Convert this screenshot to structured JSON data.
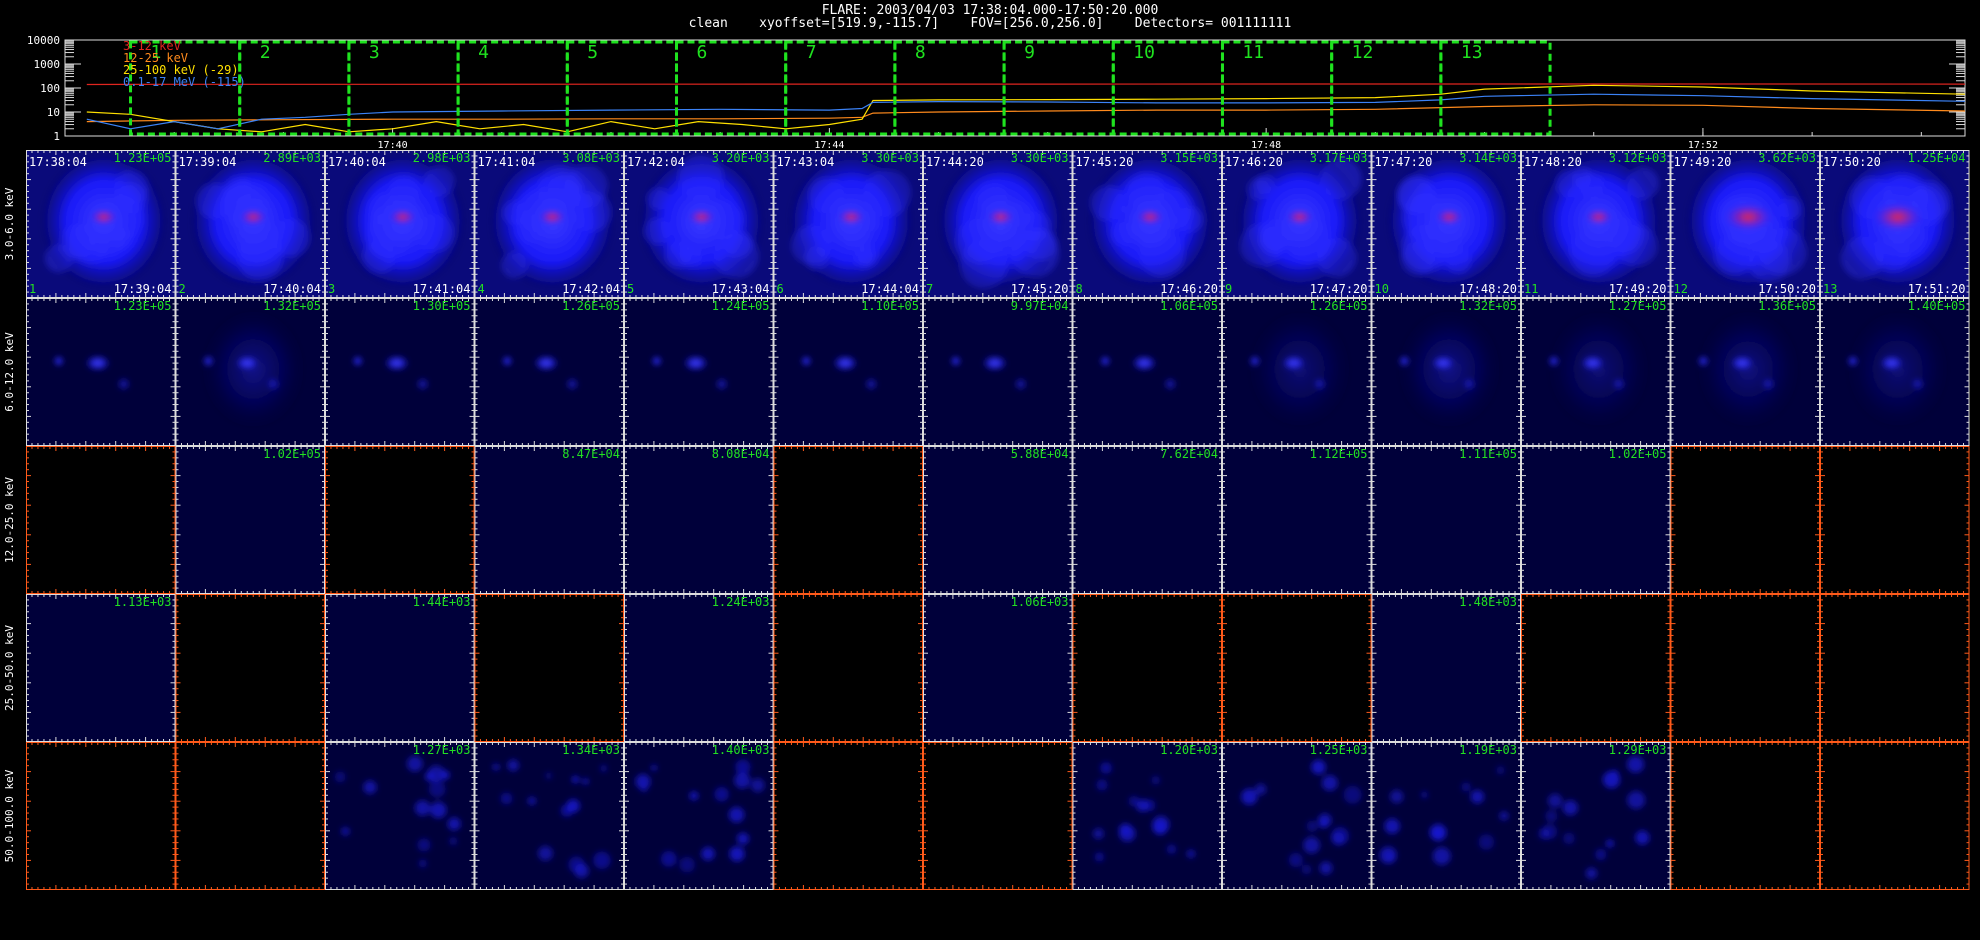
{
  "header": {
    "line1": "FLARE: 2003/04/03 17:38:04.000-17:50:20.000",
    "line2": "clean    xyoffset=[519.9,-115.7]    FOV=[256.0,256.0]    Detectors= 001111111"
  },
  "colors": {
    "c3_12": "#e0251f",
    "c12_25": "#ff8a1c",
    "c25_100": "#ffe000",
    "c100_17": "#3b82f6",
    "green_box": "#1fe21f",
    "intensity_label": "#22e022",
    "axis_white": "#dddddd",
    "axis_orange": "#ff5a1a",
    "image_blue": "#1a1aff",
    "image_red": "#ff2020"
  },
  "chart_data": [
    {
      "type": "line",
      "title": "",
      "y_scale": "log",
      "ylim": [
        1,
        10000
      ],
      "y_ticks": [
        "10000",
        "1000",
        "100",
        "10",
        "1"
      ],
      "x_ticks": [
        "17:40",
        "17:44",
        "17:48",
        "17:52"
      ],
      "x_tick_minutes": [
        40,
        44,
        48,
        52
      ],
      "xlim_minutes": [
        37.0,
        54.4
      ],
      "legend": {
        "placement": "top-left",
        "entries": [
          "3-12 keV",
          "12-25 keV",
          "25-100 keV (-29)",
          "0.1-17 MeV (-115)"
        ]
      },
      "series": [
        {
          "name": "3-12 keV",
          "color_key": "c3_12",
          "x": [
            37.2,
            38.0,
            40.0,
            42.0,
            44.0,
            45.0,
            46.0,
            48.0,
            50.0,
            52.0,
            54.4
          ],
          "values": [
            140,
            142,
            143,
            144,
            145,
            146,
            146,
            147,
            147,
            147,
            146
          ]
        },
        {
          "name": "12-25 keV",
          "color_key": "c12_25",
          "x": [
            37.2,
            38.0,
            39.0,
            40.0,
            41.0,
            42.0,
            43.0,
            44.0,
            44.3,
            44.4,
            45.0,
            46.0,
            47.0,
            48.0,
            49.0,
            50.0,
            51.0,
            52.0,
            53.0,
            54.4
          ],
          "values": [
            4,
            4.5,
            4.8,
            5,
            5,
            5.2,
            5.2,
            5.5,
            6,
            9,
            10,
            11,
            12,
            12,
            13,
            17,
            20,
            19,
            14,
            11
          ]
        },
        {
          "name": "25-100 keV (-29)",
          "color_key": "c25_100",
          "x": [
            37.2,
            37.6,
            38.0,
            38.4,
            38.8,
            39.2,
            39.6,
            40.0,
            40.4,
            40.8,
            41.2,
            41.6,
            42.0,
            42.4,
            42.8,
            43.2,
            43.6,
            44.0,
            44.3,
            44.4,
            45.0,
            46.0,
            47.0,
            48.0,
            49.0,
            49.6,
            50.0,
            51.0,
            52.0,
            53.0,
            54.4
          ],
          "values": [
            10,
            8,
            4,
            2,
            1.5,
            3,
            1.5,
            2,
            4,
            2,
            3,
            1.5,
            4,
            2,
            4,
            3,
            2,
            3,
            5,
            30,
            32,
            33,
            34,
            36,
            40,
            55,
            90,
            130,
            110,
            75,
            55
          ]
        },
        {
          "name": "0.1-17 MeV (-115)",
          "color_key": "c100_17",
          "x": [
            37.2,
            37.6,
            38.0,
            38.4,
            38.8,
            39.2,
            39.6,
            40.0,
            41.0,
            42.0,
            43.0,
            44.0,
            44.3,
            44.4,
            45.0,
            46.0,
            47.0,
            48.0,
            49.0,
            49.6,
            50.0,
            51.0,
            52.0,
            53.0,
            54.4
          ],
          "values": [
            5,
            2,
            4,
            2,
            5,
            6,
            8,
            10,
            11,
            12,
            13,
            12,
            14,
            25,
            27,
            26,
            24,
            24,
            25,
            32,
            45,
            55,
            48,
            36,
            28
          ]
        }
      ],
      "intervals": [
        {
          "label": "1",
          "start": 37.6,
          "end": 38.6
        },
        {
          "label": "2",
          "start": 38.6,
          "end": 39.6
        },
        {
          "label": "3",
          "start": 39.6,
          "end": 40.6
        },
        {
          "label": "4",
          "start": 40.6,
          "end": 41.6
        },
        {
          "label": "5",
          "start": 41.6,
          "end": 42.6
        },
        {
          "label": "6",
          "start": 42.6,
          "end": 43.6
        },
        {
          "label": "7",
          "start": 43.6,
          "end": 44.6
        },
        {
          "label": "8",
          "start": 44.6,
          "end": 45.6
        },
        {
          "label": "9",
          "start": 45.6,
          "end": 46.6
        },
        {
          "label": "10",
          "start": 46.6,
          "end": 47.6
        },
        {
          "label": "11",
          "start": 47.6,
          "end": 48.6
        },
        {
          "label": "12",
          "start": 48.6,
          "end": 49.6
        },
        {
          "label": "13",
          "start": 49.6,
          "end": 50.6
        }
      ]
    },
    {
      "type": "heatmap",
      "title": "",
      "rows": [
        "3.0-6.0 keV",
        "6.0-12.0 keV",
        "12.0-25.0 keV",
        "25.0-50.0 keV",
        "50.0-100.0 keV"
      ],
      "columns": [
        {
          "index": "1",
          "start": "17:38:04",
          "end": "17:39:04"
        },
        {
          "index": "2",
          "start": "17:39:04",
          "end": "17:40:04"
        },
        {
          "index": "3",
          "start": "17:40:04",
          "end": "17:41:04"
        },
        {
          "index": "4",
          "start": "17:41:04",
          "end": "17:42:04"
        },
        {
          "index": "5",
          "start": "17:42:04",
          "end": "17:43:04"
        },
        {
          "index": "6",
          "start": "17:43:04",
          "end": "17:44:04"
        },
        {
          "index": "7",
          "start": "17:44:20",
          "end": "17:45:20"
        },
        {
          "index": "8",
          "start": "17:45:20",
          "end": "17:46:20"
        },
        {
          "index": "9",
          "start": "17:46:20",
          "end": "17:47:20"
        },
        {
          "index": "10",
          "start": "17:47:20",
          "end": "17:48:20"
        },
        {
          "index": "11",
          "start": "17:48:20",
          "end": "17:49:20"
        },
        {
          "index": "12",
          "start": "17:49:20",
          "end": "17:50:20"
        },
        {
          "index": "13",
          "start": "17:50:20",
          "end": "17:51:20"
        }
      ],
      "peaks": [
        [
          "1.23E+05",
          "2.89E+03",
          "2.98E+03",
          "3.08E+03",
          "3.20E+03",
          "3.30E+03",
          "3.30E+03",
          "3.15E+03",
          "3.17E+03",
          "3.14E+03",
          "3.12E+03",
          "3.62E+03",
          "1.25E+04"
        ],
        [
          "1.23E+05",
          "1.32E+05",
          "1.30E+05",
          "1.26E+05",
          "1.24E+05",
          "1.10E+05",
          "9.97E+04",
          "1.06E+05",
          "1.26E+05",
          "1.32E+05",
          "1.27E+05",
          "1.36E+05",
          "1.40E+05"
        ],
        [
          "",
          "1.02E+05",
          "",
          "8.47E+04",
          "8.08E+04",
          "",
          "5.88E+04",
          "7.62E+04",
          "1.12E+05",
          "1.11E+05",
          "1.02E+05",
          "",
          ""
        ],
        [
          "1.13E+03",
          "",
          "1.44E+03",
          "",
          "1.24E+03",
          "",
          "1.06E+03",
          "",
          "",
          "1.48E+03",
          "",
          "",
          ""
        ],
        [
          "",
          "",
          "1.27E+03",
          "1.34E+03",
          "1.40E+03",
          "",
          "",
          "1.20E+03",
          "1.25E+03",
          "1.19E+03",
          "1.29E+03",
          "",
          ""
        ]
      ],
      "axis_color": [
        [
          "w",
          "w",
          "w",
          "w",
          "w",
          "w",
          "w",
          "w",
          "w",
          "w",
          "w",
          "w",
          "w"
        ],
        [
          "w",
          "w",
          "w",
          "w",
          "w",
          "w",
          "w",
          "w",
          "w",
          "w",
          "w",
          "w",
          "w"
        ],
        [
          "o",
          "w",
          "o",
          "w",
          "w",
          "o",
          "w",
          "w",
          "w",
          "w",
          "w",
          "o",
          "o"
        ],
        [
          "w",
          "o",
          "w",
          "o",
          "w",
          "o",
          "w",
          "o",
          "o",
          "w",
          "o",
          "o",
          "o"
        ],
        [
          "o",
          "o",
          "w",
          "w",
          "w",
          "o",
          "o",
          "w",
          "w",
          "w",
          "w",
          "o",
          "o"
        ]
      ],
      "intensity": [
        [
          1.0,
          1.0,
          1.0,
          1.0,
          1.0,
          1.0,
          1.0,
          1.0,
          1.0,
          1.0,
          1.0,
          1.0,
          1.0
        ],
        [
          0.15,
          0.45,
          0.12,
          0.12,
          0.12,
          0.12,
          0.12,
          0.16,
          0.35,
          0.45,
          0.35,
          0.4,
          0.35
        ],
        [
          0,
          0.15,
          0,
          0.15,
          0.15,
          0,
          0.15,
          0.15,
          0.15,
          0.15,
          0.15,
          0,
          0
        ],
        [
          0.15,
          0,
          0.15,
          0,
          0.15,
          0,
          0.15,
          0,
          0,
          0.15,
          0,
          0,
          0
        ],
        [
          0,
          0,
          0.25,
          0.3,
          0.35,
          0,
          0,
          0.25,
          0.25,
          0.3,
          0.3,
          0,
          0
        ]
      ]
    }
  ]
}
